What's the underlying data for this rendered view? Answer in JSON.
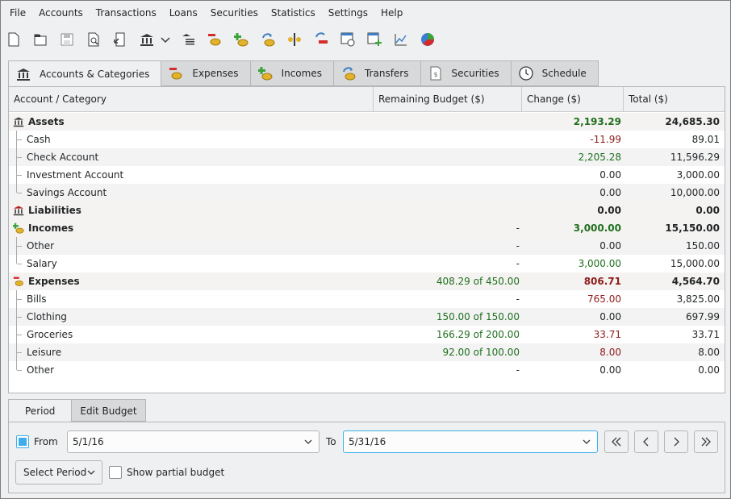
{
  "menu": [
    "File",
    "Accounts",
    "Transactions",
    "Loans",
    "Securities",
    "Statistics",
    "Settings",
    "Help"
  ],
  "toolbar_icons": [
    "new-file-icon",
    "open-folder-icon",
    "save-icon",
    "print-preview-icon",
    "export-icon",
    "accounts-bank-icon",
    "dropdown-arrow-icon",
    "categories-icon",
    "new-expense-icon",
    "new-income-icon",
    "new-transfer-icon",
    "split-transaction-icon",
    "edit-transaction-icon",
    "schedule-icon",
    "add-budget-icon",
    "line-chart-icon",
    "pie-chart-icon"
  ],
  "tabs": [
    {
      "label": "Accounts & Categories",
      "icon": "bank-icon"
    },
    {
      "label": "Expenses",
      "icon": "expense-coins-icon"
    },
    {
      "label": "Incomes",
      "icon": "income-coins-icon"
    },
    {
      "label": "Transfers",
      "icon": "transfer-icon"
    },
    {
      "label": "Securities",
      "icon": "securities-icon"
    },
    {
      "label": "Schedule",
      "icon": "clock-icon"
    }
  ],
  "table": {
    "columns": [
      "Account / Category",
      "Remaining Budget ($)",
      "Change ($)",
      "Total ($)"
    ],
    "rows": [
      {
        "name": "Assets",
        "budget": "",
        "change": "2,193.29",
        "total": "24,685.30"
      },
      {
        "name": "Cash",
        "budget": "",
        "change": "-11.99",
        "total": "89.01"
      },
      {
        "name": "Check Account",
        "budget": "",
        "change": "2,205.28",
        "total": "11,596.29"
      },
      {
        "name": "Investment Account",
        "budget": "",
        "change": "0.00",
        "total": "3,000.00"
      },
      {
        "name": "Savings Account",
        "budget": "",
        "change": "0.00",
        "total": "10,000.00"
      },
      {
        "name": "Liabilities",
        "budget": "",
        "change": "0.00",
        "total": "0.00"
      },
      {
        "name": "Incomes",
        "budget": "-",
        "change": "3,000.00",
        "total": "15,150.00"
      },
      {
        "name": "Other",
        "budget": "-",
        "change": "0.00",
        "total": "150.00"
      },
      {
        "name": "Salary",
        "budget": "-",
        "change": "3,000.00",
        "total": "15,000.00"
      },
      {
        "name": "Expenses",
        "budget": "408.29 of 450.00",
        "change": "806.71",
        "total": "4,564.70"
      },
      {
        "name": "Bills",
        "budget": "-",
        "change": "765.00",
        "total": "3,825.00"
      },
      {
        "name": "Clothing",
        "budget": "150.00 of 150.00",
        "change": "0.00",
        "total": "697.99"
      },
      {
        "name": "Groceries",
        "budget": "166.29 of 200.00",
        "change": "33.71",
        "total": "33.71"
      },
      {
        "name": "Leisure",
        "budget": "92.00 of 100.00",
        "change": "8.00",
        "total": "8.00"
      },
      {
        "name": "Other",
        "budget": "-",
        "change": "0.00",
        "total": "0.00"
      }
    ]
  },
  "bottom_tabs": [
    "Period",
    "Edit Budget"
  ],
  "period": {
    "from_label": "From",
    "from_value": "5/1/16",
    "to_label": "To",
    "to_value": "5/31/16",
    "select_period": "Select Period",
    "show_partial": "Show partial budget"
  },
  "colors": {
    "positive": "#1e6f1e",
    "negative": "#8e1b1b",
    "accent": "#3daee9"
  }
}
